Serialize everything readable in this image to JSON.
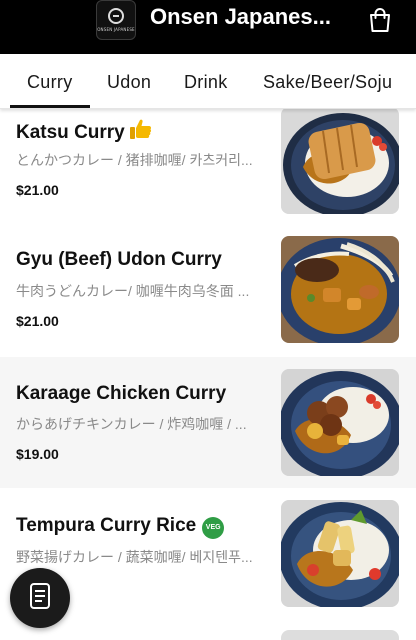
{
  "header": {
    "title": "Onsen Japanes...",
    "logo_text": "ONSEN JAPANESE"
  },
  "tabs": [
    {
      "label": "Curry",
      "active": true
    },
    {
      "label": "Udon",
      "active": false
    },
    {
      "label": "Drink",
      "active": false
    },
    {
      "label": "Sake/Beer/Soju",
      "active": false
    }
  ],
  "menu_items": [
    {
      "name": "Katsu Curry",
      "badge": "thumbs-up-icon",
      "subtitle": "とんかつカレー / 猪排咖喱/ 카츠커리...",
      "price": "$21.00"
    },
    {
      "name": "Gyu (Beef) Udon Curry",
      "badge": "",
      "subtitle": "牛肉うどんカレー/ 咖喱牛肉乌冬面 ...",
      "price": "$21.00"
    },
    {
      "name": "Karaage Chicken Curry",
      "badge": "",
      "subtitle": "からあげチキンカレー / 炸鸡咖喱 / ...",
      "price": "$19.00"
    },
    {
      "name": "Tempura Curry Rice",
      "badge": "VEG",
      "subtitle": "野菜揚げカレー / 蔬菜咖喱/ 베지텐푸...",
      "price": ""
    }
  ],
  "icons": {
    "cart": "shopping-bag-icon",
    "fab": "menu-document-icon"
  },
  "colors": {
    "header_bg": "#000000",
    "veg_badge": "#2f9d45",
    "thumbs_up": "#f5b800"
  }
}
